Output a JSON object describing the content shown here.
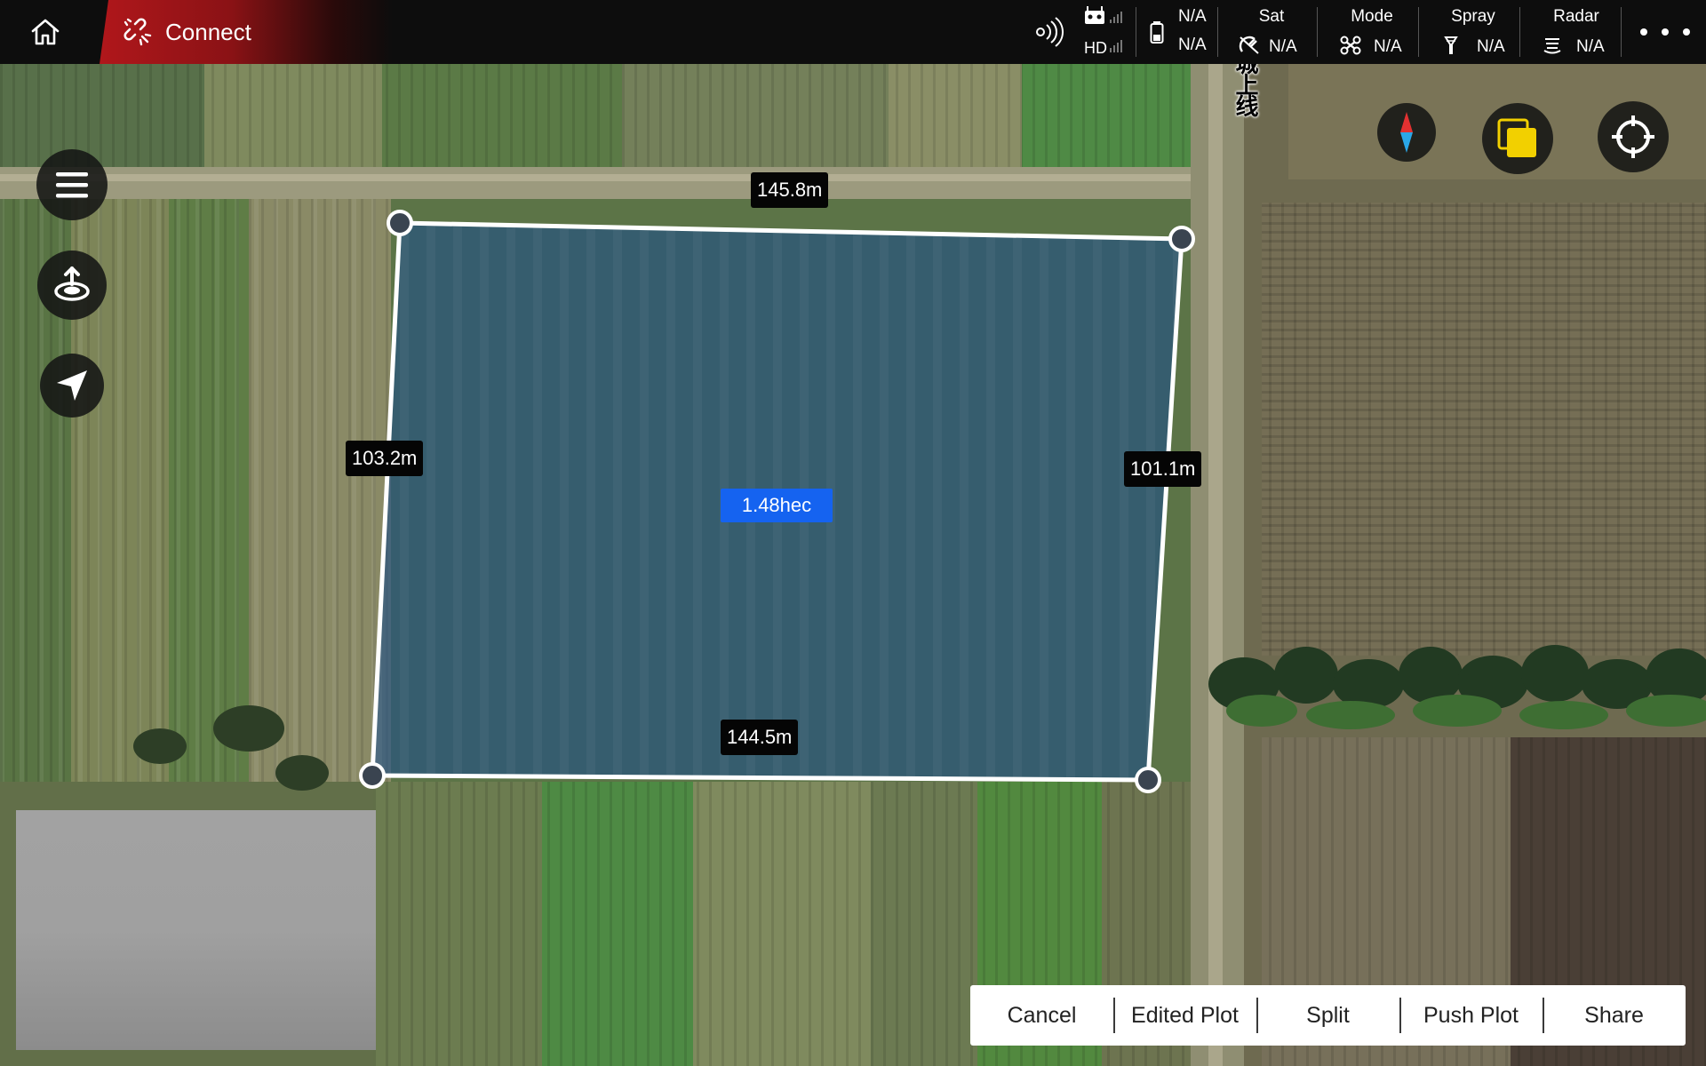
{
  "topbar": {
    "connect_label": "Connect",
    "signal": {
      "rc_value": "N/A",
      "hd_label": "HD",
      "hd_value": "N/A"
    },
    "status_items": [
      {
        "title": "Sat",
        "value": "N/A",
        "icon": "satellite-icon"
      },
      {
        "title": "Mode",
        "value": "N/A",
        "icon": "drone-icon"
      },
      {
        "title": "Spray",
        "value": "N/A",
        "icon": "spray-icon"
      },
      {
        "title": "Radar",
        "value": "N/A",
        "icon": "radar-icon"
      }
    ]
  },
  "map": {
    "road_label": "城上线",
    "plot": {
      "top_length": "145.8m",
      "left_length": "103.2m",
      "right_length": "101.1m",
      "bottom_length": "144.5m",
      "area": "1.48hec"
    }
  },
  "actions": {
    "cancel": "Cancel",
    "edited_plot": "Edited Plot",
    "split": "Split",
    "push_plot": "Push Plot",
    "share": "Share"
  },
  "colors": {
    "accent_red": "#b0171b",
    "area_blue": "#1563f0",
    "plot_fill": "#1f4f86",
    "layers_yellow": "#f2d000"
  }
}
